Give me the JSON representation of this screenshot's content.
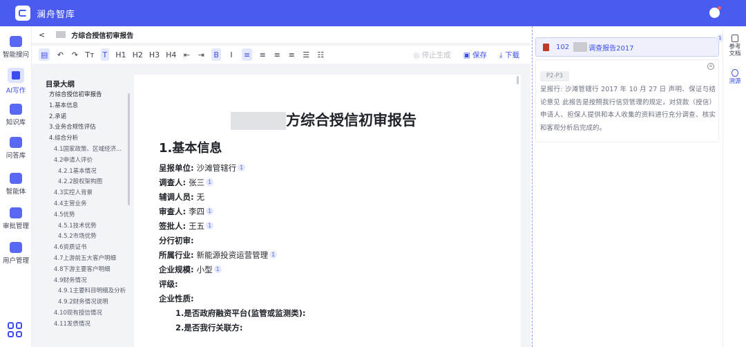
{
  "app": {
    "brand": "澜舟智库"
  },
  "nav": [
    {
      "label": "智能搜问",
      "icon": "chat-icon",
      "color": "#3c4df0"
    },
    {
      "label": "AI写作",
      "icon": "ai-write-icon",
      "color": "#3c4df0",
      "active": true
    },
    {
      "label": "知识库",
      "icon": "books-icon",
      "color": "#3c4df0"
    },
    {
      "label": "问答库",
      "icon": "qa-icon",
      "color": "#3c4df0"
    },
    {
      "label": "智能体",
      "icon": "robot-icon",
      "color": "#3c4df0"
    },
    {
      "label": "审批管理",
      "icon": "approval-icon",
      "color": "#3c4df0"
    },
    {
      "label": "用户管理",
      "icon": "user-manage-icon",
      "color": "#3c4df0"
    }
  ],
  "header": {
    "back": "<",
    "title": "方综合授信初审报告"
  },
  "toolbar": {
    "buttons": [
      "▤",
      "↶",
      "↷",
      "Tт",
      "T",
      "H1",
      "H2",
      "H3",
      "H4",
      "⇤",
      "⇥",
      "B",
      "I",
      "≡",
      "≡",
      "≡",
      "≡",
      "☰",
      "☷"
    ],
    "stop": "停止生成",
    "save": "保存",
    "download": "下载"
  },
  "outline": {
    "title": "目录大纲",
    "items": [
      {
        "text": "方综合授信初审报告",
        "level": "l0"
      },
      {
        "text": "1.基本信息",
        "level": "l1"
      },
      {
        "text": "2.承诺",
        "level": "l1"
      },
      {
        "text": "3.业务合规性评估",
        "level": "l1"
      },
      {
        "text": "4.综合分析",
        "level": "l1"
      },
      {
        "text": "4.1国家政策、区域经济...",
        "level": "l2"
      },
      {
        "text": "4.2申请人评价",
        "level": "l2"
      },
      {
        "text": "4.2.1基本情况",
        "level": "l3"
      },
      {
        "text": "4.2.2股权架构图",
        "level": "l3"
      },
      {
        "text": "4.3实控人背景",
        "level": "l2"
      },
      {
        "text": "4.4主营业务",
        "level": "l2"
      },
      {
        "text": "4.5优势",
        "level": "l2"
      },
      {
        "text": "4.5.1技术优势",
        "level": "l3"
      },
      {
        "text": "4.5.2市场优势",
        "level": "l3"
      },
      {
        "text": "4.6资质证书",
        "level": "l2"
      },
      {
        "text": "4.7上游前五大客户明细",
        "level": "l2"
      },
      {
        "text": "4.8下游主要客户明细",
        "level": "l2"
      },
      {
        "text": "4.9财务情况",
        "level": "l2"
      },
      {
        "text": "4.9.1主要科目明细及分析",
        "level": "l3"
      },
      {
        "text": "4.9.2财务情况说明",
        "level": "l3"
      },
      {
        "text": "4.10现有授信情况",
        "level": "l2"
      },
      {
        "text": "4.11发债情况",
        "level": "l2"
      }
    ]
  },
  "document": {
    "title": "方综合授信初审报告",
    "section": "1.基本信息",
    "fields": [
      {
        "key": "呈报单位:",
        "value": "沙滩管辖行",
        "ref": "1"
      },
      {
        "key": "调查人:",
        "value": "张三",
        "ref": "1"
      },
      {
        "key": "辅调人员:",
        "value": "无",
        "ref": ""
      },
      {
        "key": "审查人:",
        "value": "李四",
        "ref": "1"
      },
      {
        "key": "签批人:",
        "value": "王五",
        "ref": "1"
      },
      {
        "key": "分行初审:",
        "value": "",
        "ref": ""
      },
      {
        "key": "所属行业:",
        "value": "新能源投资运营管理",
        "ref": "1"
      },
      {
        "key": "企业规模:",
        "value": "小型",
        "ref": "1"
      },
      {
        "key": "评级:",
        "value": "",
        "ref": ""
      },
      {
        "key": "企业性质:",
        "value": "",
        "ref": ""
      }
    ],
    "subitems": [
      "1.是否政府融资平台(监管或监测类):",
      "2.是否我行关联方:"
    ]
  },
  "reference": {
    "num": "102",
    "name": "调查报告2017",
    "badge": "1",
    "page": "P2-P3",
    "text": "呈报行: 沙滩管辖行 2017 年 10 月 27 日 声明、保证与结论意见 此报告是按照我行信贷管理的规定，对贷款（授信）申请人、担保人提供和本人收集的资料进行充分调查、核实和客观分析后完成的。"
  },
  "rightrail": [
    {
      "label": "参考文档",
      "icon": "document-icon"
    },
    {
      "label": "溯源",
      "icon": "trace-icon",
      "active": true
    }
  ]
}
